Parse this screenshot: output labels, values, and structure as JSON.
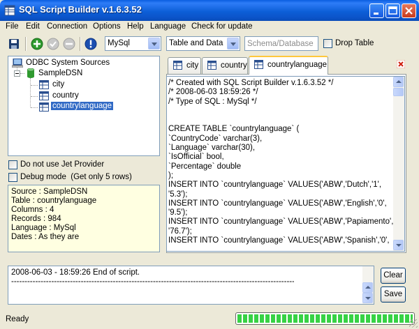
{
  "window": {
    "title": "SQL Script Builder v.1.6.3.52"
  },
  "menu": [
    "File",
    "Edit",
    "Connection",
    "Options",
    "Help",
    "Language",
    "Check for update"
  ],
  "toolbar": {
    "sql_type": "MySql",
    "mode": "Table and Data",
    "schema_placeholder": "Schema/Database",
    "drop_table_label": "Drop Table"
  },
  "tree": {
    "root": "ODBC System Sources",
    "dsn": "SampleDSN",
    "tables": [
      "city",
      "country",
      "countrylanguage"
    ],
    "selected": "countrylanguage"
  },
  "options": {
    "no_jet_label": "Do not use Jet Provider",
    "debug_label": "Debug mode  (Get only 5 rows)"
  },
  "info": [
    "Source : SampleDSN",
    "Table : countrylanguage",
    "Columns : 4",
    "Records : 984",
    "Language : MySql",
    "Dates : As they are"
  ],
  "tabs": [
    {
      "label": "city"
    },
    {
      "label": "country"
    },
    {
      "label": "countrylanguage"
    }
  ],
  "script_lines": [
    "/* Created with SQL Script Builder v.1.6.3.52 */",
    "/* 2008-06-03 18:59:26 */",
    "/* Type of SQL : MySql */",
    "",
    "",
    "CREATE TABLE `countrylanguage` (",
    "`CountryCode` varchar(3),",
    "`Language` varchar(30),",
    "`IsOfficial` bool,",
    "`Percentage` double",
    ");",
    "INSERT INTO `countrylanguage` VALUES('ABW','Dutch','1',",
    "'5.3');",
    "INSERT INTO `countrylanguage` VALUES('ABW','English','0',",
    "'9.5');",
    "INSERT INTO `countrylanguage` VALUES('ABW','Papiamento','0',",
    "'76.7');",
    "INSERT INTO `countrylanguage` VALUES('ABW','Spanish','0',"
  ],
  "log_lines": [
    "2008-06-03 - 18:59:26 End of script.",
    "------------------------------------------------------------------------------------------------------------"
  ],
  "buttons": {
    "clear": "Clear",
    "save": "Save"
  },
  "status": {
    "text": "Ready",
    "progress": 1.0
  },
  "colors": {
    "selection": "#316AC5",
    "info_bg": "#FFFFE1",
    "progress": "#37D245"
  }
}
